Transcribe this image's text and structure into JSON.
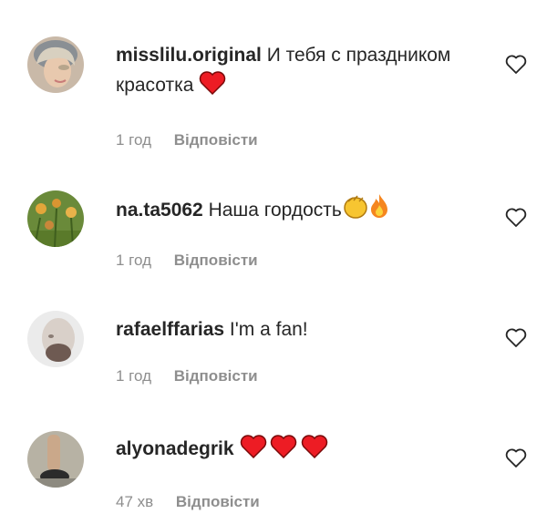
{
  "comments": [
    {
      "username": "misslilu.original",
      "text": "И тебя с праздником красотка",
      "time": "1 год",
      "reply_label": "Відповісти",
      "emojis": [
        "red-heart"
      ]
    },
    {
      "username": "na.ta5062",
      "text": "Наша гордость",
      "time": "1 год",
      "reply_label": "Відповісти",
      "emojis": [
        "clapping-hands",
        "fire"
      ]
    },
    {
      "username": "rafaelffarias",
      "text": "I'm a fan!",
      "time": "1 год",
      "reply_label": "Відповісти",
      "emojis": []
    },
    {
      "username": "alyonadegrik",
      "text": "",
      "time": "47 хв",
      "reply_label": "Відповісти",
      "emojis": [
        "red-heart",
        "red-heart",
        "red-heart"
      ]
    }
  ],
  "colors": {
    "text": "#262626",
    "secondary": "#8e8e8e",
    "heart": "#ed1c24"
  }
}
